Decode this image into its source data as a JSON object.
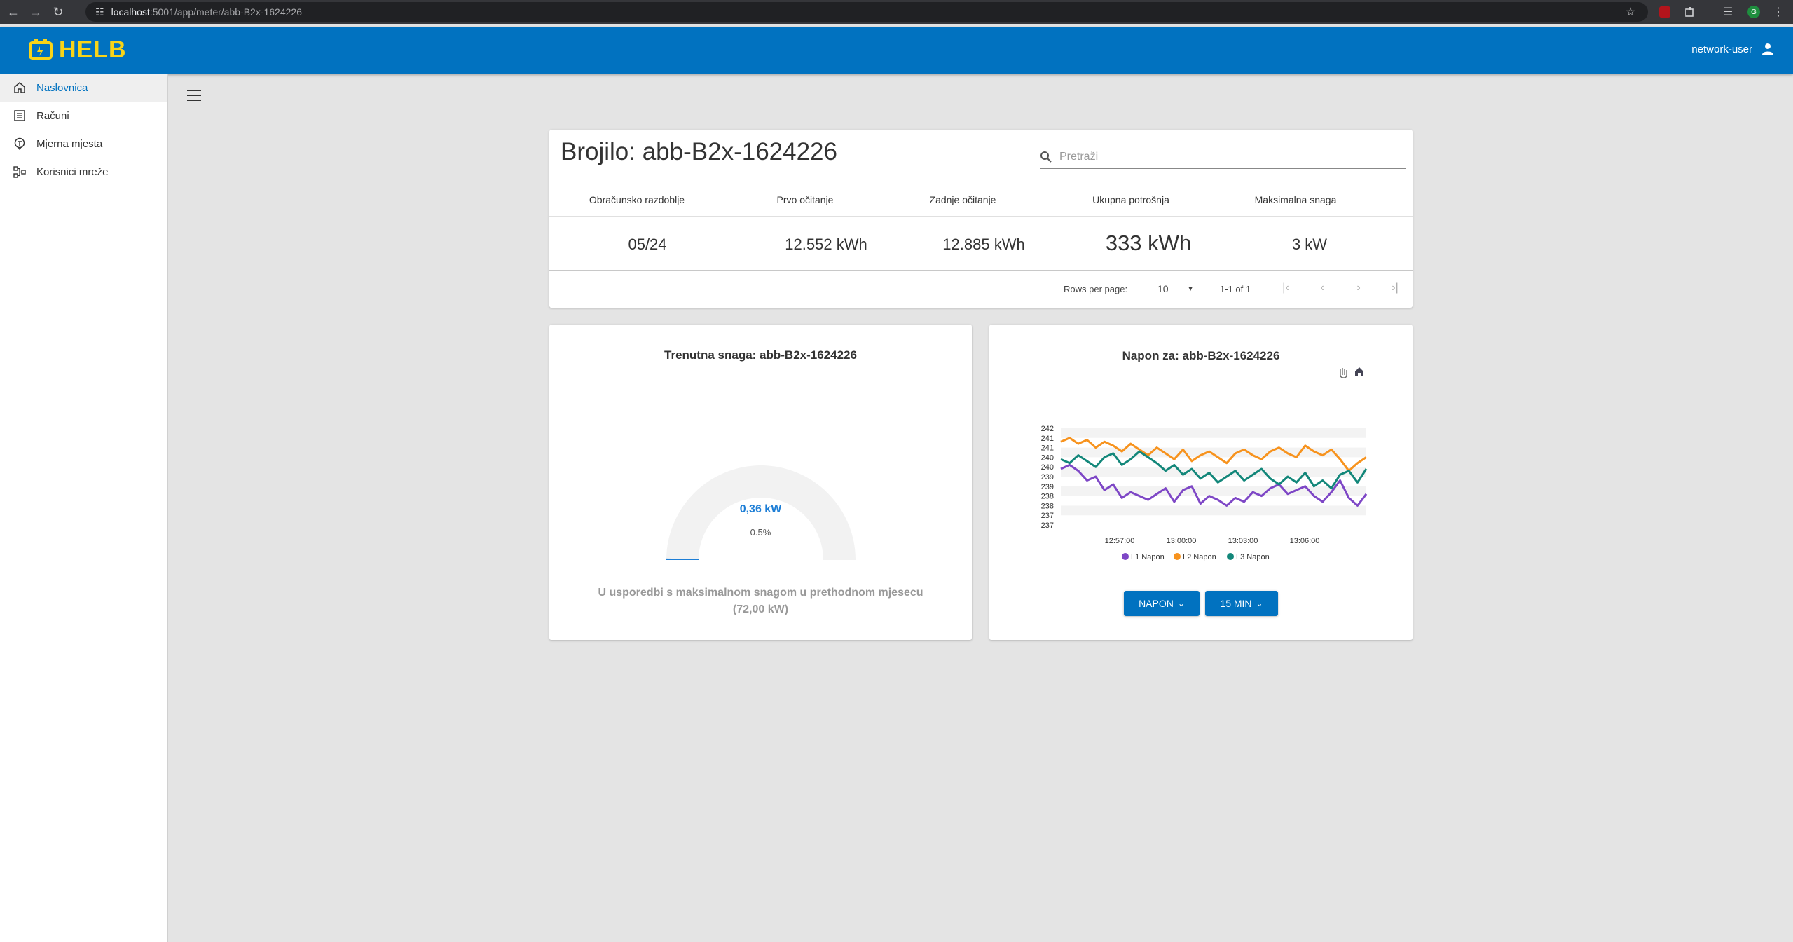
{
  "browser": {
    "url_host": "localhost",
    "url_rest": ":5001/app/meter/abb-B2x-1624226"
  },
  "header": {
    "logo_text": "HELB",
    "user": "network-user"
  },
  "sidebar": {
    "items": [
      {
        "label": "Naslovnica",
        "icon": "home-icon",
        "active": true
      },
      {
        "label": "Računi",
        "icon": "list-icon"
      },
      {
        "label": "Mjerna mjesta",
        "icon": "location-icon"
      },
      {
        "label": "Korisnici mreže",
        "icon": "network-icon"
      }
    ]
  },
  "meter": {
    "title": "Brojilo: abb-B2x-1624226",
    "search_placeholder": "Pretraži",
    "columns": [
      "Obračunsko razdoblje",
      "Prvo očitanje",
      "Zadnje očitanje",
      "Ukupna potrošnja",
      "Maksimalna snaga"
    ],
    "row": [
      "05/24",
      "12.552 kWh",
      "12.885 kWh",
      "333 kWh",
      "3 kW"
    ],
    "pager": {
      "rows_label": "Rows per page:",
      "rows_value": "10",
      "range": "1-1 of 1"
    }
  },
  "gauge": {
    "title": "Trenutna snaga: abb-B2x-1624226",
    "value": "0,36 kW",
    "percent": "0.5%",
    "percent_value": 0.5,
    "note": "U usporedbi s maksimalnom snagom u prethodnom mjesecu (72,00 kW)",
    "color": "#1d7ed6"
  },
  "voltage_chart": {
    "title": "Napon za: abb-B2x-1624226",
    "buttons": {
      "type": "NAPON",
      "interval": "15 MIN"
    },
    "toolbar_icons": [
      "pan-hand-icon",
      "home-icon"
    ]
  },
  "chart_data": {
    "type": "line",
    "title": "Napon za: abb-B2x-1624226",
    "y_tick_labels": [
      "242",
      "241",
      "241",
      "240",
      "240",
      "239",
      "239",
      "238",
      "238",
      "237",
      "237"
    ],
    "x_tick_labels": [
      "12:57:00",
      "13:00:00",
      "13:03:00",
      "13:06:00"
    ],
    "ylim": [
      237,
      242
    ],
    "grid": "horizontal bands",
    "legend_position": "bottom",
    "series": [
      {
        "name": "L1 Napon",
        "color": "#7e47c6",
        "values": [
          239.9,
          240.1,
          239.8,
          239.3,
          239.5,
          238.8,
          239.1,
          238.4,
          238.7,
          238.5,
          238.3,
          238.6,
          238.9,
          238.2,
          238.8,
          239.0,
          238.1,
          238.5,
          238.3,
          238.0,
          238.4,
          238.2,
          238.7,
          238.5,
          238.9,
          239.1,
          238.6,
          238.8,
          239.0,
          238.5,
          238.2,
          238.7,
          239.3,
          238.4,
          238.0,
          238.6
        ]
      },
      {
        "name": "L2 Napon",
        "color": "#f7931e",
        "values": [
          241.3,
          241.5,
          241.2,
          241.4,
          241.0,
          241.3,
          241.1,
          240.8,
          241.2,
          240.9,
          240.6,
          241.0,
          240.7,
          240.4,
          240.9,
          240.3,
          240.6,
          240.8,
          240.5,
          240.2,
          240.7,
          240.9,
          240.6,
          240.4,
          240.8,
          241.0,
          240.7,
          240.5,
          241.1,
          240.8,
          240.6,
          240.9,
          240.4,
          239.8,
          240.2,
          240.5
        ]
      },
      {
        "name": "L3 Napon",
        "color": "#13877a",
        "values": [
          240.4,
          240.2,
          240.6,
          240.3,
          240.0,
          240.5,
          240.7,
          240.1,
          240.4,
          240.8,
          240.5,
          240.2,
          239.8,
          240.1,
          239.6,
          239.9,
          239.4,
          239.7,
          239.2,
          239.5,
          239.8,
          239.3,
          239.6,
          239.9,
          239.4,
          239.1,
          239.5,
          239.2,
          239.7,
          239.0,
          239.3,
          238.9,
          239.6,
          239.8,
          239.2,
          239.9
        ]
      }
    ]
  }
}
